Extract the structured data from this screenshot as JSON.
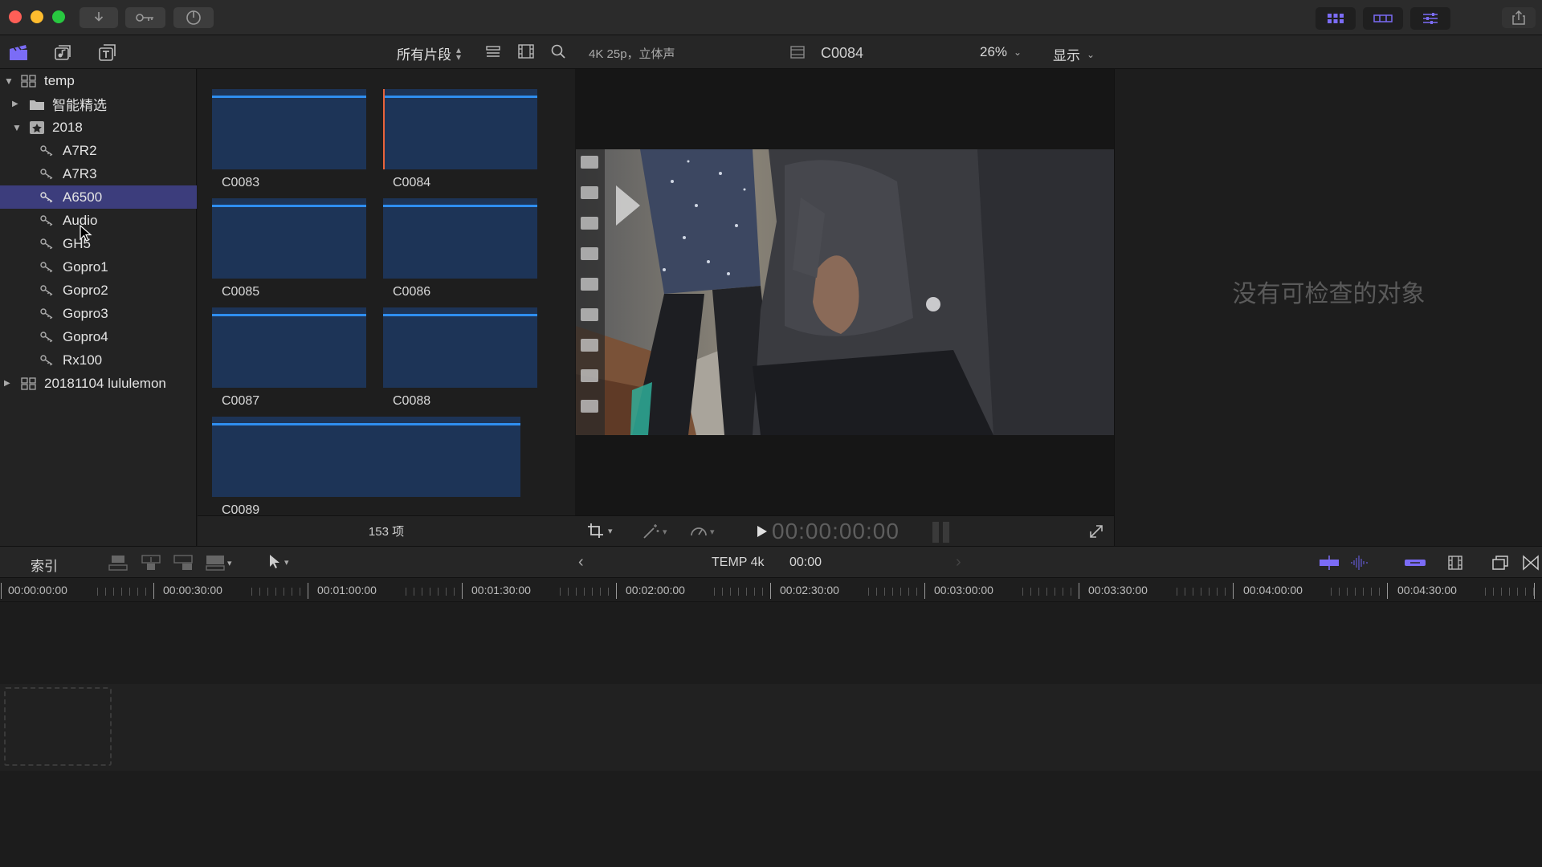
{
  "toolbar": {
    "traffic_colors": [
      "#fe5f57",
      "#febc2e",
      "#28c840"
    ],
    "import_icon": "download-icon",
    "keywords_icon": "key-icon",
    "background_tasks_icon": "progress-icon"
  },
  "browser": {
    "filter_label": "所有片段",
    "search_icon": "search-icon"
  },
  "viewer": {
    "format_label": "4K 25p，立体声",
    "clip_name": "C0084",
    "zoom": "26%",
    "display_label": "显示",
    "timecode": "00:00:00:00"
  },
  "inspector": {
    "empty_message": "没有可检查的对象"
  },
  "libraries": [
    {
      "label": "temp",
      "level": 0,
      "expanded": true,
      "icon": "library-icon"
    },
    {
      "label": "智能精选",
      "level": 1,
      "expanded": false,
      "icon": "folder-icon"
    },
    {
      "label": "2018",
      "level": 1,
      "expanded": true,
      "icon": "event-icon"
    },
    {
      "label": "A7R2",
      "level": 2,
      "icon": "keyword-collection-icon"
    },
    {
      "label": "A7R3",
      "level": 2,
      "icon": "keyword-collection-icon"
    },
    {
      "label": "A6500",
      "level": 2,
      "icon": "keyword-collection-icon",
      "selected": true
    },
    {
      "label": "Audio",
      "level": 2,
      "icon": "keyword-collection-icon"
    },
    {
      "label": "GH5",
      "level": 2,
      "icon": "keyword-collection-icon"
    },
    {
      "label": "Gopro1",
      "level": 2,
      "icon": "keyword-collection-icon"
    },
    {
      "label": "Gopro2",
      "level": 2,
      "icon": "keyword-collection-icon"
    },
    {
      "label": "Gopro3",
      "level": 2,
      "icon": "keyword-collection-icon"
    },
    {
      "label": "Gopro4",
      "level": 2,
      "icon": "keyword-collection-icon"
    },
    {
      "label": "Rx100",
      "level": 2,
      "icon": "keyword-collection-icon"
    },
    {
      "label": "20181104 lululemon",
      "level": 0,
      "expanded": false,
      "icon": "library-icon"
    }
  ],
  "clips": [
    "C0083",
    "C0084",
    "C0085",
    "C0086",
    "C0087",
    "C0088",
    "C0089"
  ],
  "clip_count": "153 项",
  "timeline": {
    "index_label": "索引",
    "project_name": "TEMP 4k",
    "duration": "00:00",
    "ruler": [
      "00:00:00:00",
      "00:00:30:00",
      "00:01:00:00",
      "00:01:30:00",
      "00:02:00:00",
      "00:02:30:00",
      "00:03:00:00",
      "00:03:30:00",
      "00:04:00:00",
      "00:04:30:00"
    ]
  },
  "colors": {
    "accent": "#2f8ef0",
    "selection": "#3c3d7c",
    "clip_thumb": "#1d3457",
    "purple_icon": "#7b6cf6"
  }
}
